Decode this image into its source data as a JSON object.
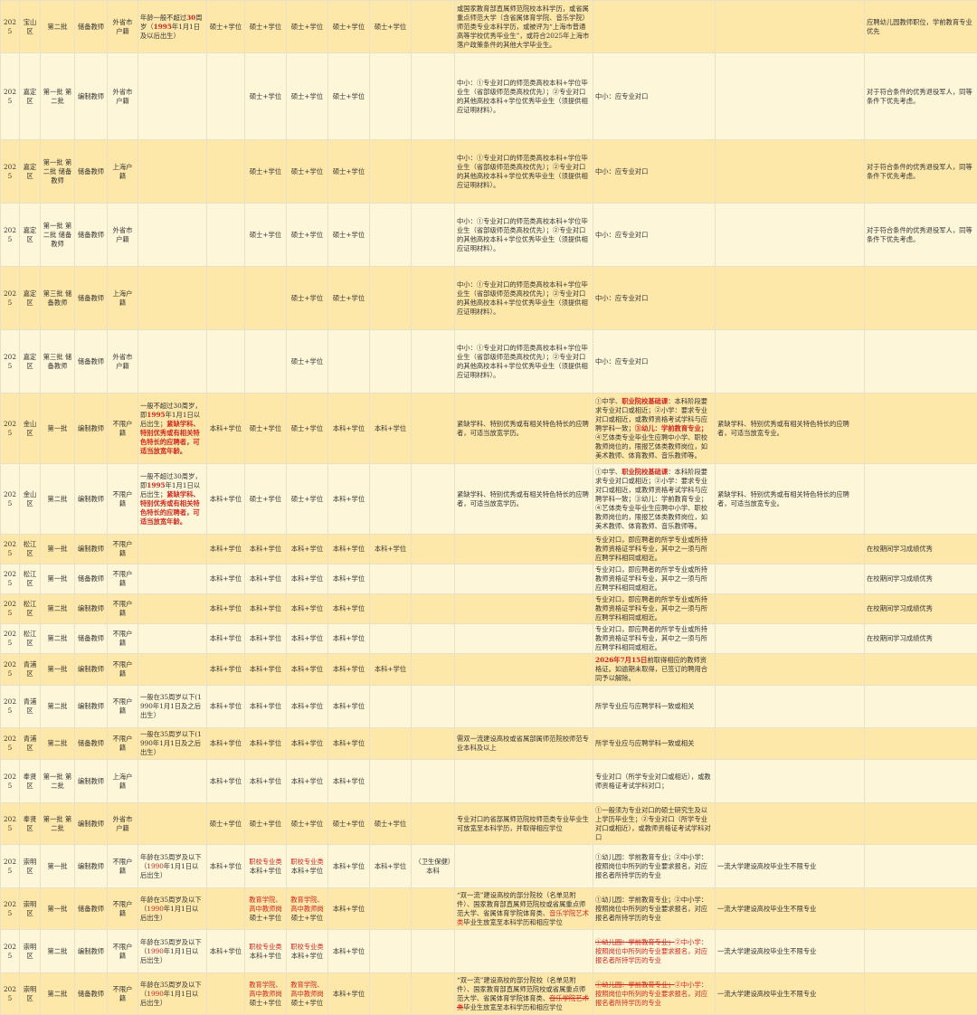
{
  "rows": [
    {
      "h": 58,
      "y": "2025",
      "d": "宝山区",
      "b": "第二批",
      "t": "储备教师",
      "hk": "外省市户籍",
      "age": [
        {
          "t": "年龄一般不超过"
        },
        {
          "t": "30",
          "c": "bred"
        },
        {
          "t": "周岁（"
        },
        {
          "t": "1995",
          "c": "bred"
        },
        {
          "t": "年1月1日及以后出生）"
        }
      ],
      "e1": "硕士+学位",
      "e2": "硕士+学位",
      "e3": "硕士+学位",
      "e4": "硕士+学位",
      "e5": "硕士+学位",
      "e6": "",
      "sch": [
        {
          "t": "或国家教育部直属师范院校本科学历，或省属重点师范大学（含省属体育学院、音乐学院）师范类专业本科学历，或被评为“上海市普通高等学校优秀毕业生”，或符合2025年上海市落户政策条件的其他大学毕业生。"
        }
      ],
      "maj": [],
      "o1": "",
      "o2": "应聘幼儿园教师职位，学前教育专业优先"
    },
    {
      "h": 96,
      "y": "2025",
      "d": "嘉定区",
      "b": "第一批 第二批",
      "t": "编制教师",
      "hk": "外省市户籍",
      "age": [],
      "e1": "",
      "e2": "硕士+学位",
      "e3": "硕士+学位",
      "e4": "硕士+学位",
      "e5": "",
      "e6": "",
      "sch": [
        {
          "t": "中小：①专业对口的师范类高校本科+学位毕业生（省部级师范类高校优先）；②专业对口的其他高校本科+学位优秀毕业生（须提供相应证明材料）。"
        }
      ],
      "maj": [
        {
          "t": "中小：应专业对口"
        }
      ],
      "o1": "",
      "o2": "对于符合条件的优秀退役军人，同等条件下优先考虑。"
    },
    {
      "h": 70,
      "y": "2025",
      "d": "嘉定区",
      "b": "第一批 第二批 储备教师",
      "t": "储备教师",
      "hk": "上海户籍",
      "age": [],
      "e1": "",
      "e2": "硕士+学位",
      "e3": "硕士+学位",
      "e4": "硕士+学位",
      "e5": "",
      "e6": "",
      "sch": [
        {
          "t": "中小：①专业对口的师范类高校本科+学位毕业生（省部级师范类高校优先）；②专业对口的其他高校本科+学位优秀毕业生（须提供相应证明材料）。"
        }
      ],
      "maj": [
        {
          "t": "中小：应专业对口"
        }
      ],
      "o1": "",
      "o2": "对于符合条件的优秀退役军人，同等条件下优先考虑。"
    },
    {
      "h": 70,
      "y": "2025",
      "d": "嘉定区",
      "b": "第一批 第二批 储备教师",
      "t": "储备教师",
      "hk": "外省市户籍",
      "age": [],
      "e1": "",
      "e2": "硕士+学位",
      "e3": "硕士+学位",
      "e4": "硕士+学位",
      "e5": "",
      "e6": "",
      "sch": [
        {
          "t": "中小：①专业对口的师范类高校本科+学位毕业生（省部级师范类高校优先）；②专业对口的其他高校本科+学位优秀毕业生（须提供相应证明材料）。"
        }
      ],
      "maj": [
        {
          "t": "中小：应专业对口"
        }
      ],
      "o1": "",
      "o2": "对于符合条件的优秀退役军人，同等条件下优先考虑。"
    },
    {
      "h": 70,
      "y": "2025",
      "d": "嘉定区",
      "b": "第三批 储备教师",
      "t": "储备教师",
      "hk": "上海户籍",
      "age": [],
      "e1": "",
      "e2": "",
      "e3": "硕士+学位",
      "e4": "硕士+学位",
      "e5": "",
      "e6": "",
      "sch": [
        {
          "t": "中小：①专业对口的师范类高校本科+学位毕业生（省部级师范类高校优先）；②专业对口的其他高校本科+学位优秀毕业生（须提供相应证明材料）。"
        }
      ],
      "maj": [
        {
          "t": "中小：应专业对口"
        }
      ],
      "o1": "",
      "o2": ""
    },
    {
      "h": 70,
      "y": "2025",
      "d": "嘉定区",
      "b": "第三批 储备教师",
      "t": "储备教师",
      "hk": "外省市户籍",
      "age": [],
      "e1": "",
      "e2": "",
      "e3": "硕士+学位",
      "e4": "",
      "e5": "",
      "e6": "",
      "sch": [
        {
          "t": "中小：①专业对口的师范类高校本科+学位毕业生（省部级师范类高校优先）；②专业对口的其他高校本科+学位优秀毕业生（须提供相应证明材料）。"
        }
      ],
      "maj": [
        {
          "t": "中小：应专业对口"
        }
      ],
      "o1": "",
      "o2": ""
    },
    {
      "h": 78,
      "y": "2025",
      "d": "金山区",
      "b": "第一批",
      "t": "编制教师",
      "hk": "不限户籍",
      "age": [
        {
          "t": "一般不超过30周岁，即"
        },
        {
          "t": "1995",
          "c": "bred"
        },
        {
          "t": "年1月1日以后出生；"
        },
        {
          "t": "紧缺学科、特别优秀或有相关特色特长的应聘者，可适当放宽年龄。",
          "c": "bred"
        }
      ],
      "e1": "本科+学位",
      "e2": "硕士+学位",
      "e3": "硕士+学位",
      "e4": "本科+学位",
      "e5": "本科+学位",
      "e6": "",
      "sch": [
        {
          "t": "紧缺学科、特别优秀或有相关特色特长的应聘者，可适当放宽学历。"
        }
      ],
      "maj": [
        {
          "t": "①中学、"
        },
        {
          "t": "职业院校基础课",
          "c": "bred"
        },
        {
          "t": "：本科阶段要求专业对口或相近；②小学：要求专业对口或相近，或教师资格考试学科与应聘学科一致；"
        },
        {
          "t": "③幼儿：学前教育专业；",
          "c": "bred"
        },
        {
          "t": "④艺体类专业毕业生应聘中小学、职校教师岗位的，限报艺体类教师岗位，如美术教师、体育教师、音乐教师等。"
        }
      ],
      "o1": "紧缺学科、特别优秀或有相关特色特长的应聘者，可适当放宽专业。",
      "o2": ""
    },
    {
      "h": 78,
      "y": "2025",
      "d": "金山区",
      "b": "第二批",
      "t": "编制教师",
      "hk": "不限户籍",
      "age": [
        {
          "t": "一般不超过30周岁，即"
        },
        {
          "t": "1995",
          "c": "bred"
        },
        {
          "t": "年1月1日以后出生；"
        },
        {
          "t": "紧缺学科、特别优秀或有相关特色特长的应聘者，可适当放宽年龄。",
          "c": "bred"
        }
      ],
      "e1": "本科+学位",
      "e2": "硕士+学位",
      "e3": "硕士+学位",
      "e4": "本科+学位",
      "e5": "",
      "e6": "",
      "sch": [
        {
          "t": "紧缺学科、特别优秀或有相关特色特长的应聘者，可适当放宽学历。"
        }
      ],
      "maj": [
        {
          "t": "①中学、"
        },
        {
          "t": "职业院校基础课",
          "c": "bred"
        },
        {
          "t": "：本科阶段要求专业对口或相近；②小学：要求专业对口或相近，或教师资格考试学科与应聘学科一致；③幼儿：学前教育专业；④艺体类专业毕业生应聘中小学、职校教师岗位的，限报艺体类教师岗位，如美术教师、体育教师、音乐教师等。"
        }
      ],
      "o1": "紧缺学科、特别优秀或有相关特色特长的应聘者，可适当放宽专业。",
      "o2": ""
    },
    {
      "h": 31,
      "y": "2025",
      "d": "松江区",
      "b": "第一批",
      "t": "编制教师",
      "hk": "不限户籍",
      "age": [],
      "e1": "本科+学位",
      "e2": "本科+学位",
      "e3": "本科+学位",
      "e4": "本科+学位",
      "e5": "本科+学位",
      "e6": "",
      "sch": [],
      "maj": [
        {
          "t": "专业对口，即应聘者的所学专业或所持教师资格证学科专业，其中之一须与所应聘学科相同或相近。"
        }
      ],
      "o1": "",
      "o2": "在校期间学习成绩优秀"
    },
    {
      "h": 32,
      "y": "2025",
      "d": "松江区",
      "b": "第一批",
      "t": "储备教师",
      "hk": "不限户籍",
      "age": [],
      "e1": "本科+学位",
      "e2": "本科+学位",
      "e3": "本科+学位",
      "e4": "本科+学位",
      "e5": "",
      "e6": "",
      "sch": [],
      "maj": [
        {
          "t": "专业对口，即应聘者的所学专业或所持教师资格证学科专业，其中之一须与所应聘学科相同或相近。"
        }
      ],
      "o1": "",
      "o2": "在校期间学习成绩优秀"
    },
    {
      "h": 32,
      "y": "2025",
      "d": "松江区",
      "b": "第二批",
      "t": "编制教师",
      "hk": "不限户籍",
      "age": [],
      "e1": "本科+学位",
      "e2": "本科+学位",
      "e3": "本科+学位",
      "e4": "本科+学位",
      "e5": "",
      "e6": "",
      "sch": [],
      "maj": [
        {
          "t": "专业对口，即应聘者的所学专业或所持教师资格证学科专业，其中之一须与所应聘学科相同或相近。"
        }
      ],
      "o1": "",
      "o2": "在校期间学习成绩优秀"
    },
    {
      "h": 32,
      "y": "2025",
      "d": "松江区",
      "b": "第二批",
      "t": "储备教师",
      "hk": "不限户籍",
      "age": [],
      "e1": "本科+学位",
      "e2": "本科+学位",
      "e3": "本科+学位",
      "e4": "本科+学位",
      "e5": "",
      "e6": "",
      "sch": [],
      "maj": [
        {
          "t": "专业对口，即应聘者的所学专业或所持教师资格证学科专业，其中之一须与所应聘学科相同或相近。"
        }
      ],
      "o1": "",
      "o2": "在校期间学习成绩优秀"
    },
    {
      "h": 35,
      "y": "2025",
      "d": "青浦区",
      "b": "第一批",
      "t": "编制教师",
      "hk": "不限户籍",
      "age": [],
      "e1": "本科+学位",
      "e2": "本科+学位",
      "e3": "本科+学位",
      "e4": "本科+学位",
      "e5": "本科+学位",
      "e6": "",
      "sch": [],
      "maj": [
        {
          "t": "2026年7月15日",
          "c": "bred"
        },
        {
          "t": "前取得相应的教师资格证。如逾期未取得，已签订的聘用合同予以解除。"
        }
      ],
      "o1": "",
      "o2": ""
    },
    {
      "h": 47,
      "y": "2025",
      "d": "青浦区",
      "b": "第二批",
      "t": "编制教师",
      "hk": "不限户籍",
      "age": [
        {
          "t": "一般在35周岁以下(1990年1月1日及之后出生）"
        }
      ],
      "e1": "本科+学位",
      "e2": "本科+学位",
      "e3": "本科+学位",
      "e4": "本科+学位",
      "e5": "",
      "e6": "",
      "sch": [],
      "maj": [
        {
          "t": "所学专业应与应聘学科一致或相关"
        }
      ],
      "o1": "",
      "o2": ""
    },
    {
      "h": 35,
      "y": "2025",
      "d": "青浦区",
      "b": "第二批",
      "t": "储备教师",
      "hk": "不限户籍",
      "age": [
        {
          "t": "一般在35周岁以下(1990年1月1日及之后出生）"
        }
      ],
      "e1": "本科+学位",
      "e2": "本科+学位",
      "e3": "本科+学位",
      "e4": "本科+学位",
      "e5": "",
      "e6": "",
      "sch": [
        {
          "t": "需双一流建设高校或省属部属师范院校师范专业本科及以上"
        }
      ],
      "maj": [
        {
          "t": "所学专业应与应聘学科一致或相关"
        }
      ],
      "o1": "",
      "o2": ""
    },
    {
      "h": 48,
      "y": "2025",
      "d": "奉贤区",
      "b": "第一批 第二批",
      "t": "编制教师",
      "hk": "上海户籍",
      "age": [],
      "e1": "本科+学位",
      "e2": "本科+学位",
      "e3": "本科+学位",
      "e4": "本科+学位",
      "e5": "",
      "e6": "",
      "sch": [],
      "maj": [
        {
          "t": "专业对口（所学专业对口或相近），或教师资格证考试学科对口；"
        }
      ],
      "o1": "",
      "o2": ""
    },
    {
      "h": 46,
      "y": "2025",
      "d": "奉贤区",
      "b": "第一批 第二批",
      "t": "编制教师",
      "hk": "外省市户籍",
      "age": [],
      "e1": "硕士+学位",
      "e2": "硕士+学位",
      "e3": "硕士+学位",
      "e4": "硕士+学位",
      "e5": "硕士+学位",
      "e6": "",
      "sch": [
        {
          "t": "专业对口的省部属师范院校师范类专业毕业生可放宽至本科学历，并取得相应学位"
        }
      ],
      "maj": [
        {
          "t": "①一般须为专业对口的硕士研究生及以上学历毕业生；②专业对口（所学专业对口或相近），或教师资格证考试学科对口"
        }
      ],
      "o1": "",
      "o2": ""
    },
    {
      "h": 48,
      "y": "2025",
      "d": "崇明区",
      "b": "第一批",
      "t": "编制教师",
      "hk": "不限户籍",
      "age": [
        {
          "t": "年龄在35周岁及以下（"
        },
        {
          "t": "1990",
          "c": "red"
        },
        {
          "t": "年1月1日以后出生）"
        }
      ],
      "e1": "本科+学位",
      "e2": [
        {
          "t": "职校专业类",
          "c": "red"
        },
        {
          "t": "本科+学位"
        }
      ],
      "e3": [
        {
          "t": "职校专业类",
          "c": "red"
        },
        {
          "t": "本科+学位"
        }
      ],
      "e4": "本科+学位",
      "e5": "本科+学位",
      "e6": "（卫生保健）本科",
      "sch": [],
      "maj": [
        {
          "t": "①幼儿园：学前教育专业；②中小学：按照岗位中所列的专业要求报名，对应报名者所持学历的专业"
        }
      ],
      "o1": "一流大学建设高校毕业生不限专业",
      "o2": ""
    },
    {
      "h": 46,
      "y": "2025",
      "d": "崇明区",
      "b": "第一批",
      "t": "储备教师",
      "hk": "不限户籍",
      "age": [
        {
          "t": "年龄在35周岁及以下（"
        },
        {
          "t": "1990",
          "c": "red"
        },
        {
          "t": "年1月1日以后出生）"
        }
      ],
      "e1": "",
      "e2": [
        {
          "t": "教育学院、高中教师岗",
          "c": "red"
        },
        {
          "t": "硕士+学位"
        }
      ],
      "e3": [
        {
          "t": "教育学院、高中教师岗",
          "c": "red"
        },
        {
          "t": "硕士+学位"
        }
      ],
      "e4": "本科+学位",
      "e5": "",
      "e6": "",
      "sch": [
        {
          "t": "“双一流”建设高校的部分院校（名单见附件）、国家教育部直属师范院校或省属重点师范大学、省属体育学院体育类、"
        },
        {
          "t": "音乐学院艺术类",
          "c": "red"
        },
        {
          "t": "毕业生放宽至本科学历和相应学位"
        }
      ],
      "maj": [
        {
          "t": "①幼儿园：学前教育专业；②中小学：按照岗位中所列的专业要求报名，对应报名者所持学历的专业"
        }
      ],
      "o1": "一流大学建设高校毕业生不限专业",
      "o2": ""
    },
    {
      "h": 48,
      "y": "2025",
      "d": "崇明区",
      "b": "第二批",
      "t": "编制教师",
      "hk": "不限户籍",
      "age": [
        {
          "t": "年龄在35周岁及以下（"
        },
        {
          "t": "1990",
          "c": "red"
        },
        {
          "t": "年1月1日以后出生）"
        }
      ],
      "e1": "本科+学位",
      "e2": [
        {
          "t": "职校专业类",
          "c": "red"
        },
        {
          "t": "本科+学位"
        }
      ],
      "e3": [
        {
          "t": "职校专业类",
          "c": "red"
        },
        {
          "t": "本科+学位"
        }
      ],
      "e4": "本科+学位",
      "e5": "",
      "e6": "",
      "sch": [],
      "maj": [
        {
          "t": "①幼儿园：学前教育专业；",
          "c": "red strike"
        },
        {
          "t": "②中小学：按照岗位中所列的专业要求报名，对应报名者所持学历的专业",
          "c": "red"
        }
      ],
      "o1": "一流大学建设高校毕业生不限专业",
      "o2": ""
    },
    {
      "h": 46,
      "y": "2025",
      "d": "崇明区",
      "b": "第二批",
      "t": "储备教师",
      "hk": "不限户籍",
      "age": [
        {
          "t": "年龄在35周岁及以下（"
        },
        {
          "t": "1990",
          "c": "red"
        },
        {
          "t": "年1月1日以后出生）"
        }
      ],
      "e1": "",
      "e2": [
        {
          "t": "教育学院、高中教师岗",
          "c": "red"
        },
        {
          "t": "硕士+学位"
        }
      ],
      "e3": [
        {
          "t": "教育学院、高中教师岗",
          "c": "red"
        },
        {
          "t": "硕士+学位"
        }
      ],
      "e4": "本科+学位",
      "e5": "",
      "e6": "",
      "sch": [
        {
          "t": "“双一流”建设高校的部分院校（名单见附件）、国家教育部直属师范院校或省属重点师范大学、省属体育学院体育类、"
        },
        {
          "t": "音乐学院艺术类",
          "c": "red strike"
        },
        {
          "t": "毕业生放宽至本科学历和相应学位"
        }
      ],
      "maj": [
        {
          "t": "①幼儿园：学前教育专业；",
          "c": "red strike"
        },
        {
          "t": "②中小学：按照岗位中所列的专业要求报名，对应报名者所持学历的专业",
          "c": "red"
        }
      ],
      "o1": "一流大学建设高校毕业生不限专业",
      "o2": ""
    }
  ]
}
